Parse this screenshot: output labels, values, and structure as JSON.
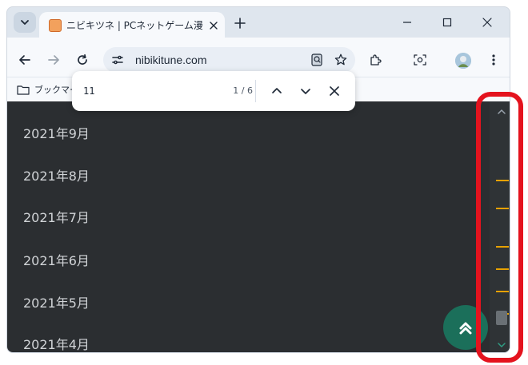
{
  "browser": {
    "tab": {
      "title": "ニビキツネ | PCネットゲーム漫画趣味"
    },
    "address_bar": {
      "url": "nibikitune.com"
    },
    "bookmarks": {
      "label": "ブックマーク"
    }
  },
  "find_bar": {
    "query": "11",
    "match_count": "1 / 6"
  },
  "page": {
    "archives": [
      "2021年9月",
      "2021年8月",
      "2021年7月",
      "2021年6月",
      "2021年5月",
      "2021年4月"
    ]
  },
  "colors": {
    "page_background": "#2b2e31",
    "scroll_marker": "#e7a100",
    "scroll_top_button": "#1b6f5a",
    "highlight_outline": "#e4131e"
  },
  "icons": [
    "tab-search-icon",
    "favicon-icon",
    "close-icon",
    "plus-icon",
    "minimize-icon",
    "maximize-icon",
    "back-icon",
    "forward-icon",
    "reload-icon",
    "site-settings-icon",
    "lens-icon",
    "star-icon",
    "extensions-icon",
    "screenshot-icon",
    "menu-icon",
    "folder-icon",
    "chevron-up-icon",
    "chevron-down-icon",
    "scroll-to-top-icon"
  ]
}
